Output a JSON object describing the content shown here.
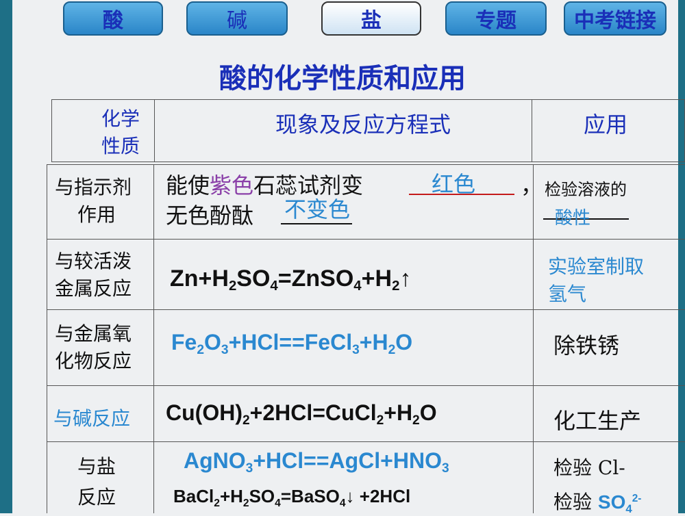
{
  "nav": {
    "acid": "酸",
    "base": "碱",
    "salt": "盐",
    "topic": "专题",
    "exam": "中考链接"
  },
  "title": "酸的化学性质和应用",
  "header": {
    "col1_line1": "化学",
    "col1_line2": "性质",
    "col2": "现象及反应方程式",
    "col3": "应用"
  },
  "rows": {
    "indicator": {
      "prop_line1": "与指示剂",
      "prop_line2": "作用",
      "text_a": "能使",
      "text_purple": "紫色",
      "text_b": "石蕊试剂变",
      "blank1": "红色",
      "comma": "，",
      "text_c": "无色酚酞",
      "blank2": "不变色",
      "app_line1": "检验溶液的",
      "app_blank": "酸性"
    },
    "metal": {
      "prop_line1": "与较活泼",
      "prop_line2": "金属反应",
      "app_line1": "实验室制取",
      "app_line2": "氢气"
    },
    "metal_oxide": {
      "prop_line1": "与金属氧",
      "prop_line2": "化物反应",
      "app": "除铁锈"
    },
    "base": {
      "prop": "与碱反应",
      "app": "化工生产"
    },
    "salt": {
      "prop_line1": "与盐",
      "prop_line2": "反应",
      "app1": "检验 Cl-",
      "app2_prefix": "检验",
      "app2_ion": "SO",
      "app2_sub": "4",
      "app2_sup": "2-"
    }
  }
}
